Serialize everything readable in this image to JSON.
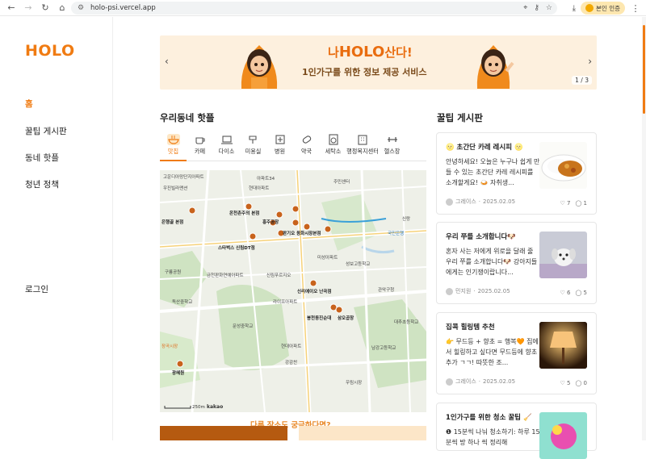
{
  "browser": {
    "url": "holo-psi.vercel.app",
    "verify_button": "본인 인증"
  },
  "sidebar": {
    "logo": "HOLO",
    "items": [
      {
        "label": "홈",
        "active": true
      },
      {
        "label": "꿀팁 게시판",
        "active": false
      },
      {
        "label": "동네 핫플",
        "active": false
      },
      {
        "label": "청년 정책",
        "active": false
      }
    ],
    "login": "로그인"
  },
  "banner": {
    "title_prefix": "나",
    "title_brand": "HOLO",
    "title_suffix": "산다!",
    "subtitle": "1인가구를 위한 정보 제공 서비스",
    "counter": "1 / 3"
  },
  "hotplace": {
    "title": "우리동네 핫플",
    "tabs": [
      {
        "label": "맛집",
        "icon": "bowl-icon",
        "active": true
      },
      {
        "label": "카페",
        "icon": "coffee-icon",
        "active": false
      },
      {
        "label": "다이소",
        "icon": "laptop-icon",
        "active": false
      },
      {
        "label": "미용실",
        "icon": "hairdryer-icon",
        "active": false
      },
      {
        "label": "병원",
        "icon": "hospital-icon",
        "active": false
      },
      {
        "label": "약국",
        "icon": "pill-icon",
        "active": false
      },
      {
        "label": "세탁소",
        "icon": "washer-icon",
        "active": false
      },
      {
        "label": "행정복지센터",
        "icon": "building-icon",
        "active": false
      },
      {
        "label": "헬스장",
        "icon": "dumbbell-icon",
        "active": false
      }
    ],
    "map_labels": [
      "고운디아망단지아파트",
      "아파트34",
      "주민센터",
      "우진빌라맨션",
      "현대아파트",
      "학원로",
      "영등포문화",
      "동원빌라",
      "은행골 본점",
      "온천촌주의 본점",
      "홍주공장",
      "인풀",
      "스타벅스 신림DT점",
      "장산린",
      "판기오 동화시장본점",
      "미성아파트",
      "성보고등학교",
      "금천판화연예아파트",
      "신림푸르지오",
      "신리에이오 난곡점",
      "봉천동진순대",
      "삼오곱창",
      "라이프아파트",
      "구룡공원",
      "문성중학교",
      "독산중학교",
      "관악구청",
      "현대아파트",
      "강감찬",
      "대추초등학교",
      "우림시장",
      "국민은행",
      "장곡시장",
      "광혜원",
      "남강고등학교",
      "신랑",
      "250m",
      "kakao"
    ],
    "more_link": "다른 장소도 궁금하다면?"
  },
  "tips": {
    "title": "꿀팁 게시판",
    "posts": [
      {
        "title": "🌝 초간단 카레 레시피 🌝",
        "body": "안녕하세요! 오늘은 누구나 쉽게 만들 수 있는 초간단 카레 레시피를 소개할게요! 🍛 자취생...",
        "author": "그레이스",
        "date": "2025.02.05",
        "likes": "7",
        "comments": "1",
        "thumb": "curry"
      },
      {
        "title": "우리 쭈를 소개합니다🐶",
        "body": "혼자 사는 저에게 위로을 달래 줄 우리 쭈를 소개합니다🐶 강아지들에게는 인기쟁이랍니다...",
        "author": "민지원",
        "date": "2025.02.05",
        "likes": "6",
        "comments": "5",
        "thumb": "dog"
      },
      {
        "title": "집콕 힐링템 추천",
        "body": "👉 무드등 + 향초 = 행복🧡 집에서 힐링하고 싶다면 무드등에 향초 추가 ㄱㄱ! 따뜻한 조...",
        "author": "그레이스",
        "date": "2025.02.05",
        "likes": "5",
        "comments": "0",
        "thumb": "lamp"
      },
      {
        "title": "1인가구를 위한 청소 꿀팁 🧹",
        "body": "❶ 15분씩 나눠 청소하기: 하루 15분씩 방 하나 씩 정리해",
        "author": "",
        "date": "",
        "likes": "",
        "comments": "",
        "thumb": "clean"
      }
    ]
  },
  "colors": {
    "accent": "#f07b12",
    "banner_bg": "#fdf0de"
  }
}
